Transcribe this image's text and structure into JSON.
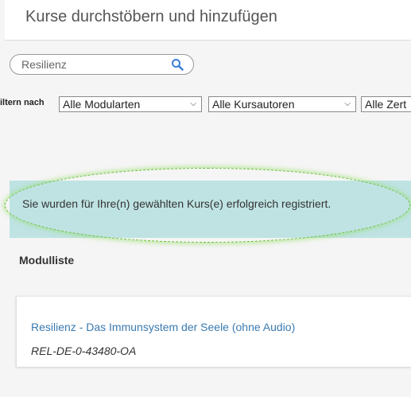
{
  "header": {
    "title": "Kurse durchstöbern und hinzufügen"
  },
  "search": {
    "value": "Resilienz"
  },
  "filters": {
    "label": "iltern nach",
    "modul_type": "Alle Modularten",
    "course_author": "Alle Kursautoren",
    "certificate": "Alle Zert"
  },
  "alert": {
    "message": "Sie wurden für Ihre(n) gewählten Kurs(e) erfolgreich registriert."
  },
  "modules": {
    "section_title": "Modulliste",
    "items": [
      {
        "title": "Resilienz - Das Immunsystem der Seele (ohne Audio)",
        "code": "REL-DE-0-43480-OA"
      }
    ]
  },
  "colors": {
    "alert_background": "#bfe3e3",
    "link": "#3a7ab0",
    "search_icon": "#3b7dd8",
    "highlight": "#6cbf3a"
  },
  "icons": {
    "search": "search-icon",
    "dropdown": "chevron-down-icon"
  }
}
